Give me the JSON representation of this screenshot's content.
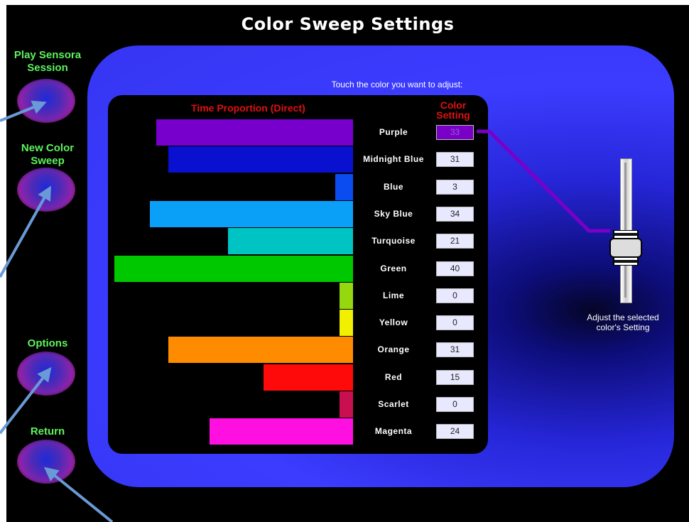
{
  "title": "Color Sweep Settings",
  "nav": {
    "play_label": "Play Sensora\nSession",
    "new_label": "New Color\nSweep",
    "options_label": "Options",
    "return_label": "Return"
  },
  "instruction": "Touch the color you want to adjust:",
  "headers": {
    "time_proportion": "Time Proportion (Direct)",
    "color_setting": "Color\nSetting"
  },
  "colors": [
    {
      "name": "Purple",
      "value": "33",
      "color": "#7700cc",
      "selected": true
    },
    {
      "name": "Midnight Blue",
      "value": "31",
      "color": "#0a10d0"
    },
    {
      "name": "Blue",
      "value": "3",
      "color": "#0a4cf0"
    },
    {
      "name": "Sky Blue",
      "value": "34",
      "color": "#0aa0f8"
    },
    {
      "name": "Turquoise",
      "value": "21",
      "color": "#00c4c4"
    },
    {
      "name": "Green",
      "value": "40",
      "color": "#00c800"
    },
    {
      "name": "Lime",
      "value": "0",
      "color": "#96d810"
    },
    {
      "name": "Yellow",
      "value": "0",
      "color": "#f0f000"
    },
    {
      "name": "Orange",
      "value": "31",
      "color": "#ff8c00"
    },
    {
      "name": "Red",
      "value": "15",
      "color": "#ff0a0a"
    },
    {
      "name": "Scarlet",
      "value": "0",
      "color": "#c81050"
    },
    {
      "name": "Magenta",
      "value": "24",
      "color": "#ff10e0"
    }
  ],
  "slider": {
    "label": "Adjust the selected\ncolor's Setting"
  },
  "accent": {
    "nav_text": "#5ef25e",
    "header_text": "#e01010",
    "arrow": "#6a9ad6"
  }
}
